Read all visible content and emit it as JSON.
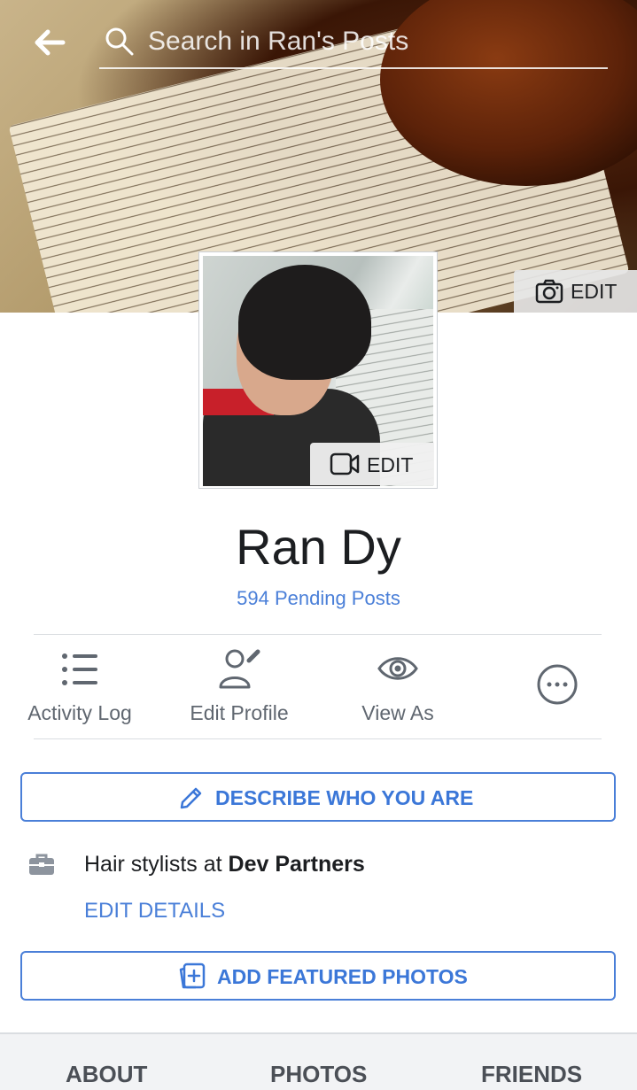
{
  "header": {
    "search_placeholder": "Search in Ran's Posts"
  },
  "cover": {
    "edit_label": "EDIT"
  },
  "profile_photo": {
    "edit_label": "EDIT"
  },
  "profile": {
    "name": "Ran Dy",
    "pending_posts": "594 Pending Posts"
  },
  "actions": [
    {
      "label": "Activity Log",
      "icon": "list-icon"
    },
    {
      "label": "Edit Profile",
      "icon": "edit-profile-icon"
    },
    {
      "label": "View As",
      "icon": "eye-icon"
    },
    {
      "label": "",
      "icon": "more-icon"
    }
  ],
  "describe_button": {
    "label": "DESCRIBE WHO YOU ARE",
    "icon": "pencil-icon"
  },
  "work": {
    "prefix": "Hair stylists at ",
    "company": "Dev Partners",
    "icon": "briefcase-icon"
  },
  "edit_details": "EDIT DETAILS",
  "featured_button": {
    "label": "ADD FEATURED PHOTOS",
    "icon": "add-photo-icon"
  },
  "tabs": [
    "ABOUT",
    "PHOTOS",
    "FRIENDS"
  ],
  "colors": {
    "accent": "#4a7fd8",
    "text": "#1c1e21",
    "muted": "#606770"
  }
}
